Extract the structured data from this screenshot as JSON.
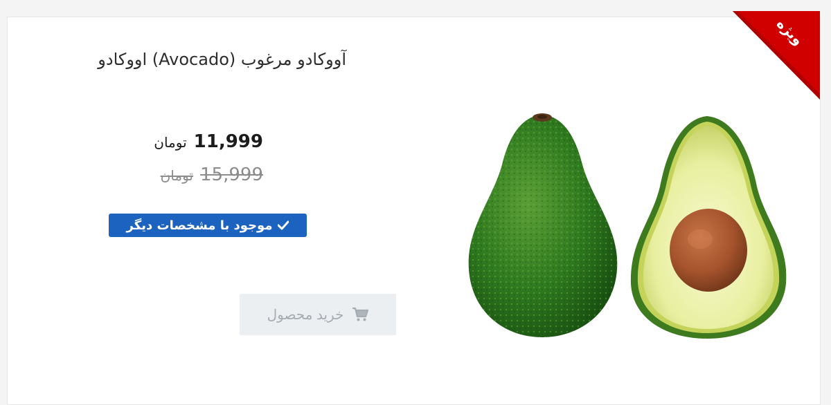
{
  "product": {
    "title": "آووکادو مرغوب (Avocado) اووکادو",
    "price": {
      "amount": "11,999",
      "unit": "تومان"
    },
    "old_price": {
      "amount": "15,999",
      "unit": "تومان"
    },
    "stock_label": "موجود با مشخصات دیگر",
    "buy_label": "خرید محصول",
    "image_icon": "avocado-image"
  },
  "ribbon": {
    "label": "ویژه",
    "color": "#d00000"
  },
  "colors": {
    "badge": "#1c63c0",
    "button_bg": "#eceff2",
    "button_text": "#a5acb3",
    "avocado_skin": "#2f7a1f",
    "avocado_flesh": "#eef3a8",
    "seed": "#a4532c"
  },
  "icons": {
    "check": "check-icon",
    "cart": "cart-icon"
  }
}
